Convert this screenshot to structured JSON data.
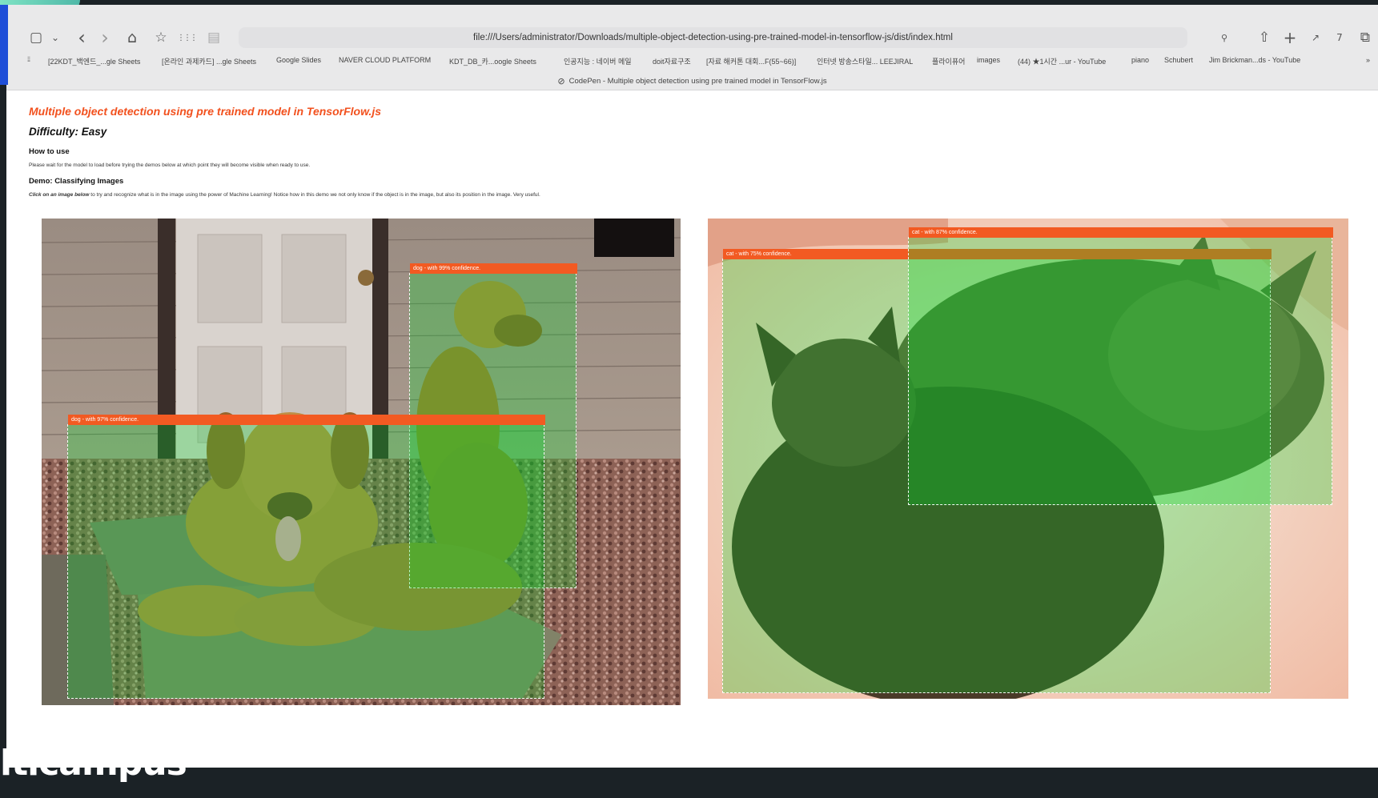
{
  "browser": {
    "url": "file:///Users/administrator/Downloads/multiple-object-detection-using-pre-trained-model-in-tensorflow-js/dist/index.html",
    "tab_title": "CodePen - Multiple object detection using pre trained model in TensorFlow.js",
    "toolbar_icons": {
      "sidebar": "▢",
      "chevron": "⌄",
      "back": "‹",
      "forward": "›",
      "home": "⌂",
      "star": "☆",
      "grid": "⋮⋮⋮",
      "reader": "▤",
      "share": "⇧",
      "new_tab": "+",
      "extension1": "↗",
      "extension2": "7",
      "tabs_overview": "⧉"
    },
    "bookmarks": [
      "[22KDT_백엔드_...gle Sheets",
      "[온라인 과제카드] ...gle Sheets",
      "Google Slides",
      "NAVER CLOUD PLATFORM",
      "KDT_DB_카...oogle Sheets",
      "인공지능 : 네이버 메일",
      "doit자료구조",
      "[자료 해커톤 대회...F(55~66)]",
      "인터넷 방송스타일... LEEJIRAL",
      "플라이퓨어",
      "images",
      "(44) ★1시간 ...ur - YouTube",
      "piano",
      "Schubert",
      "Jim Brickman...ds - YouTube"
    ],
    "bookmarks_more": "»"
  },
  "page": {
    "title": "Multiple object detection using pre trained model in TensorFlow.js",
    "difficulty": "Difficulty: Easy",
    "howto_heading": "How to use",
    "howto_text": "Please wait for the model to load before trying the demos below at which point they will become visible when ready to use.",
    "demo_heading": "Demo: Classifying Images",
    "demo_text_bold": "Click on an image below",
    "demo_text": " to try and recognize what is in the image using the power of Machine Learning! Notice how in this demo we not only know if the object is in the image, but also its position in the image. Very useful."
  },
  "detections": {
    "dogs": [
      {
        "label": "dog - with 99% confidence."
      },
      {
        "label": "dog - with 97% confidence."
      }
    ],
    "cats": [
      {
        "label": "cat - with 87% confidence."
      },
      {
        "label": "cat - with 75% confidence."
      }
    ]
  },
  "brand": "lticampus",
  "colors": {
    "accent": "#f2511e",
    "label_bg": "#f25a22",
    "highlight": "rgba(0,220,40,0.28)"
  }
}
